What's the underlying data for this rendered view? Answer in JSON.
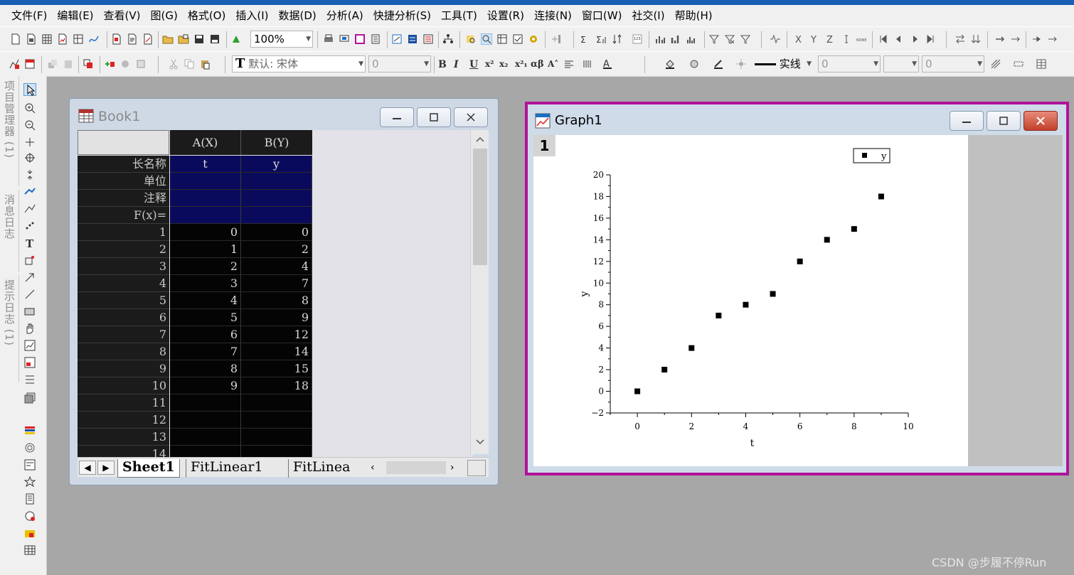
{
  "menu": [
    "文件(F)",
    "编辑(E)",
    "查看(V)",
    "图(G)",
    "格式(O)",
    "插入(I)",
    "数据(D)",
    "分析(A)",
    "快捷分析(S)",
    "工具(T)",
    "设置(R)",
    "连接(N)",
    "窗口(W)",
    "社交(I)",
    "帮助(H)"
  ],
  "toolbar": {
    "zoom": "100%",
    "font": "默认: 宋体",
    "font_size": "0",
    "line_style": "实线",
    "line_width": "0",
    "fill_value": "0"
  },
  "dock_panels": [
    "项目管理器 (1)",
    "消息日志",
    "提示日志 (1)"
  ],
  "book": {
    "title": "Book1",
    "columns": [
      "A(X)",
      "B(Y)"
    ],
    "meta_labels": [
      "长名称",
      "单位",
      "注释",
      "F(x)="
    ],
    "long_names": [
      "t",
      "y"
    ],
    "rows": [
      {
        "n": "1",
        "a": "0",
        "b": "0"
      },
      {
        "n": "2",
        "a": "1",
        "b": "2"
      },
      {
        "n": "3",
        "a": "2",
        "b": "4"
      },
      {
        "n": "4",
        "a": "3",
        "b": "7"
      },
      {
        "n": "5",
        "a": "4",
        "b": "8"
      },
      {
        "n": "6",
        "a": "5",
        "b": "9"
      },
      {
        "n": "7",
        "a": "6",
        "b": "12"
      },
      {
        "n": "8",
        "a": "7",
        "b": "14"
      },
      {
        "n": "9",
        "a": "8",
        "b": "15"
      },
      {
        "n": "10",
        "a": "9",
        "b": "18"
      },
      {
        "n": "11",
        "a": "",
        "b": ""
      },
      {
        "n": "12",
        "a": "",
        "b": ""
      },
      {
        "n": "13",
        "a": "",
        "b": ""
      },
      {
        "n": "14",
        "a": "",
        "b": ""
      }
    ],
    "tabs": [
      "Sheet1",
      "FitLinear1",
      "FitLinea"
    ]
  },
  "graph": {
    "title": "Graph1",
    "layer": "1"
  },
  "chart_data": {
    "type": "scatter",
    "x": [
      0,
      1,
      2,
      3,
      4,
      5,
      6,
      7,
      8,
      9
    ],
    "series": [
      {
        "name": "y",
        "values": [
          0,
          2,
          4,
          7,
          8,
          9,
          12,
          14,
          15,
          18
        ]
      }
    ],
    "xlabel": "t",
    "ylabel": "y",
    "xlim": [
      -1,
      10
    ],
    "ylim": [
      -2,
      20
    ],
    "xticks": [
      0,
      2,
      4,
      6,
      8,
      10
    ],
    "yticks": [
      -2,
      0,
      2,
      4,
      6,
      8,
      10,
      12,
      14,
      16,
      18,
      20
    ],
    "grid": false,
    "legend": "top-right"
  },
  "colors": {
    "graph_border": "#b0139a",
    "sheet_bg": "#040404",
    "meta_bg": "#0a0a5c"
  },
  "watermark": "CSDN @步履不停Run"
}
